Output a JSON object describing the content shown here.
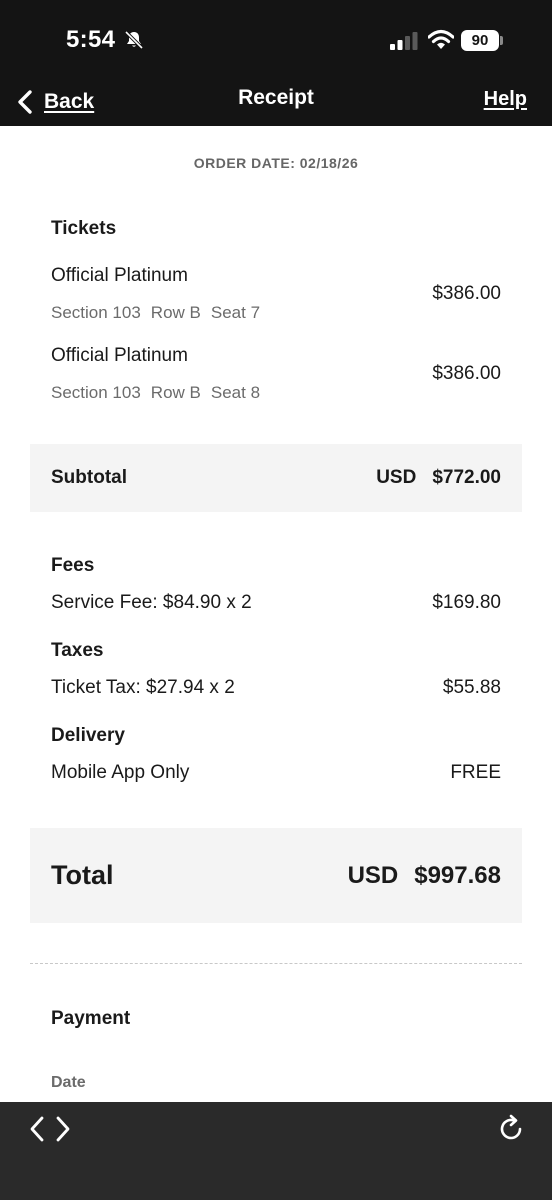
{
  "status_bar": {
    "time": "5:54",
    "battery": "90",
    "icons": [
      "bell-slash-icon",
      "cellular-signal-icon",
      "wifi-icon",
      "battery-icon"
    ]
  },
  "nav": {
    "back_label": "Back",
    "title": "Receipt",
    "help_label": "Help",
    "icons": [
      "chevron-left-icon"
    ]
  },
  "order_date": "ORDER DATE: 02/18/26",
  "tickets": {
    "heading": "Tickets",
    "items": [
      {
        "name": "Official Platinum",
        "section": "Section 103",
        "row": "Row B",
        "seat": "Seat 7",
        "price": "$386.00"
      },
      {
        "name": "Official Platinum",
        "section": "Section 103",
        "row": "Row B",
        "seat": "Seat 8",
        "price": "$386.00"
      }
    ]
  },
  "subtotal": {
    "label": "Subtotal",
    "currency": "USD",
    "amount": "$772.00"
  },
  "fees": {
    "heading": "Fees",
    "service_fee_label": "Service Fee: $84.90 x 2",
    "service_fee_amount": "$169.80"
  },
  "taxes": {
    "heading": "Taxes",
    "ticket_tax_label": "Ticket Tax: $27.94 x 2",
    "ticket_tax_amount": "$55.88"
  },
  "delivery": {
    "heading": "Delivery",
    "method": "Mobile App Only",
    "amount": "FREE"
  },
  "total": {
    "label": "Total",
    "currency": "USD",
    "amount": "$997.68"
  },
  "payment": {
    "heading": "Payment",
    "date_label": "Date"
  },
  "toolbar": {
    "icons": [
      "chevron-left-icon",
      "chevron-right-icon",
      "reload-icon"
    ]
  },
  "colors": {
    "header_bg": "#141414",
    "text_primary": "#1a1a1a",
    "text_secondary": "#6b6b6b",
    "summary_bg": "#f4f4f4",
    "toolbar_bg": "#2a2a2a"
  }
}
